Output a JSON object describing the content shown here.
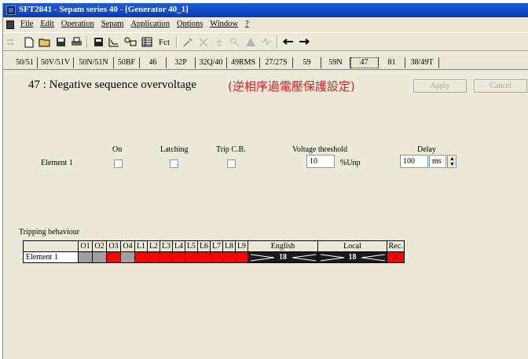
{
  "window": {
    "title": "SFT2841 - Sepam series 40 - [Generator 40_1]"
  },
  "menu": [
    "File",
    "Edit",
    "Operation",
    "Sepam",
    "Application",
    "Options",
    "Window",
    "?"
  ],
  "toolbar": {
    "fct_label": "Fct"
  },
  "tabs": [
    "50/51",
    "50V/51V",
    "50N/51N",
    "50BF",
    "46",
    "32P",
    "32Q/40",
    "49RMS",
    "27/27S",
    "59",
    "59N",
    "47",
    "81",
    "38/49T"
  ],
  "active_tab": "47",
  "page": {
    "title": "47 : Negative sequence overvoltage",
    "subtitle": "(逆相序過電壓保護設定)",
    "apply_label": "Apply",
    "cancel_label": "Cancel"
  },
  "settings": {
    "col_on": "On",
    "col_latching": "Latching",
    "col_trip": "Trip C.B.",
    "col_threshold": "Voltage threshold",
    "col_delay": "Delay",
    "row_label": "Element 1",
    "threshold_value": "10",
    "threshold_unit": "%Unp",
    "delay_value": "100",
    "delay_unit": "ms"
  },
  "tripping": {
    "title": "Tripping behaviour",
    "headers": [
      "O1",
      "O2",
      "O3",
      "O4",
      "L1",
      "L2",
      "L3",
      "L4",
      "L5",
      "L6",
      "L7",
      "L8",
      "L9"
    ],
    "english_header": "English",
    "local_header": "Local",
    "rec_header": "Rec.",
    "row_label": "Element 1",
    "cell_states": [
      "gray",
      "gray",
      "red",
      "gray",
      "red",
      "red",
      "red",
      "red",
      "red",
      "red",
      "red",
      "red",
      "red"
    ],
    "english_value": "18",
    "local_value": "18",
    "rec_value": "X"
  },
  "colors": {
    "title_bar": "#0a3db8",
    "active_red": "#ff0000",
    "subtitle": "#e02020"
  }
}
